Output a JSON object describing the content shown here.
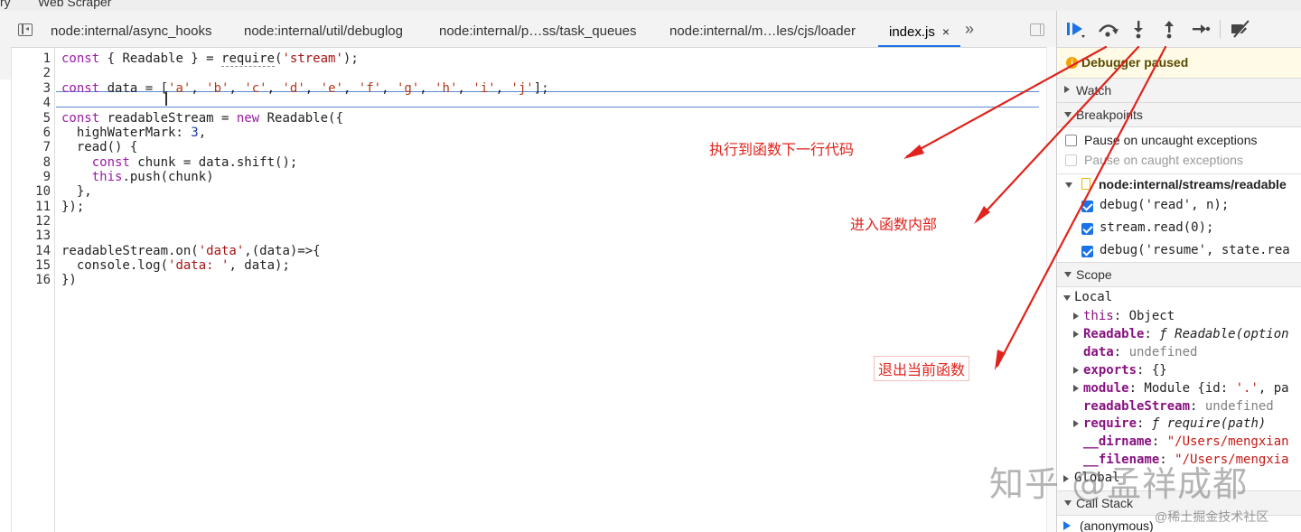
{
  "top_menu": {
    "item1": "ry",
    "item2": "Web Scraper"
  },
  "tabs": [
    {
      "label": "node:internal/async_hooks"
    },
    {
      "label": "node:internal/util/debuglog"
    },
    {
      "label": "node:internal/p…ss/task_queues"
    },
    {
      "label": "node:internal/m…les/cjs/loader"
    },
    {
      "label": "index.js",
      "close": "×",
      "active": true
    }
  ],
  "more_tabs": "»",
  "code": {
    "line_numbers": [
      "1",
      "2",
      "3",
      "4",
      "5",
      "6",
      "7",
      "8",
      "9",
      "10",
      "11",
      "12",
      "13",
      "14",
      "15",
      "16"
    ],
    "current_line": 3
  },
  "debugger": {
    "status": "Debugger paused",
    "sections": {
      "watch": "Watch",
      "breakpoints": "Breakpoints",
      "scope": "Scope",
      "call_stack": "Call Stack",
      "global": "Global"
    },
    "pause_uncaught": "Pause on uncaught exceptions",
    "pause_caught": "Pause on caught exceptions",
    "breakpoint_file": "node:internal/streams/readable",
    "breakpoints": [
      {
        "code": "debug('read', n);",
        "checked": true
      },
      {
        "code": "stream.read(0);",
        "checked": true
      },
      {
        "code": "debug('resume', state.rea",
        "checked": true
      }
    ],
    "scope_local": "Local",
    "call_stack_top": "(anonymous)"
  },
  "annotations": {
    "step_over": "执行到函数下一行代码",
    "step_into": "进入函数内部",
    "step_out": "退出当前函数"
  },
  "watermark": {
    "main": "知乎 @孟祥成都",
    "sub": "@稀土掘金技术社区"
  },
  "colors": {
    "annotation": "#e0231c",
    "accent": "#1a73e8",
    "paused_bg": "#fffbe6"
  }
}
